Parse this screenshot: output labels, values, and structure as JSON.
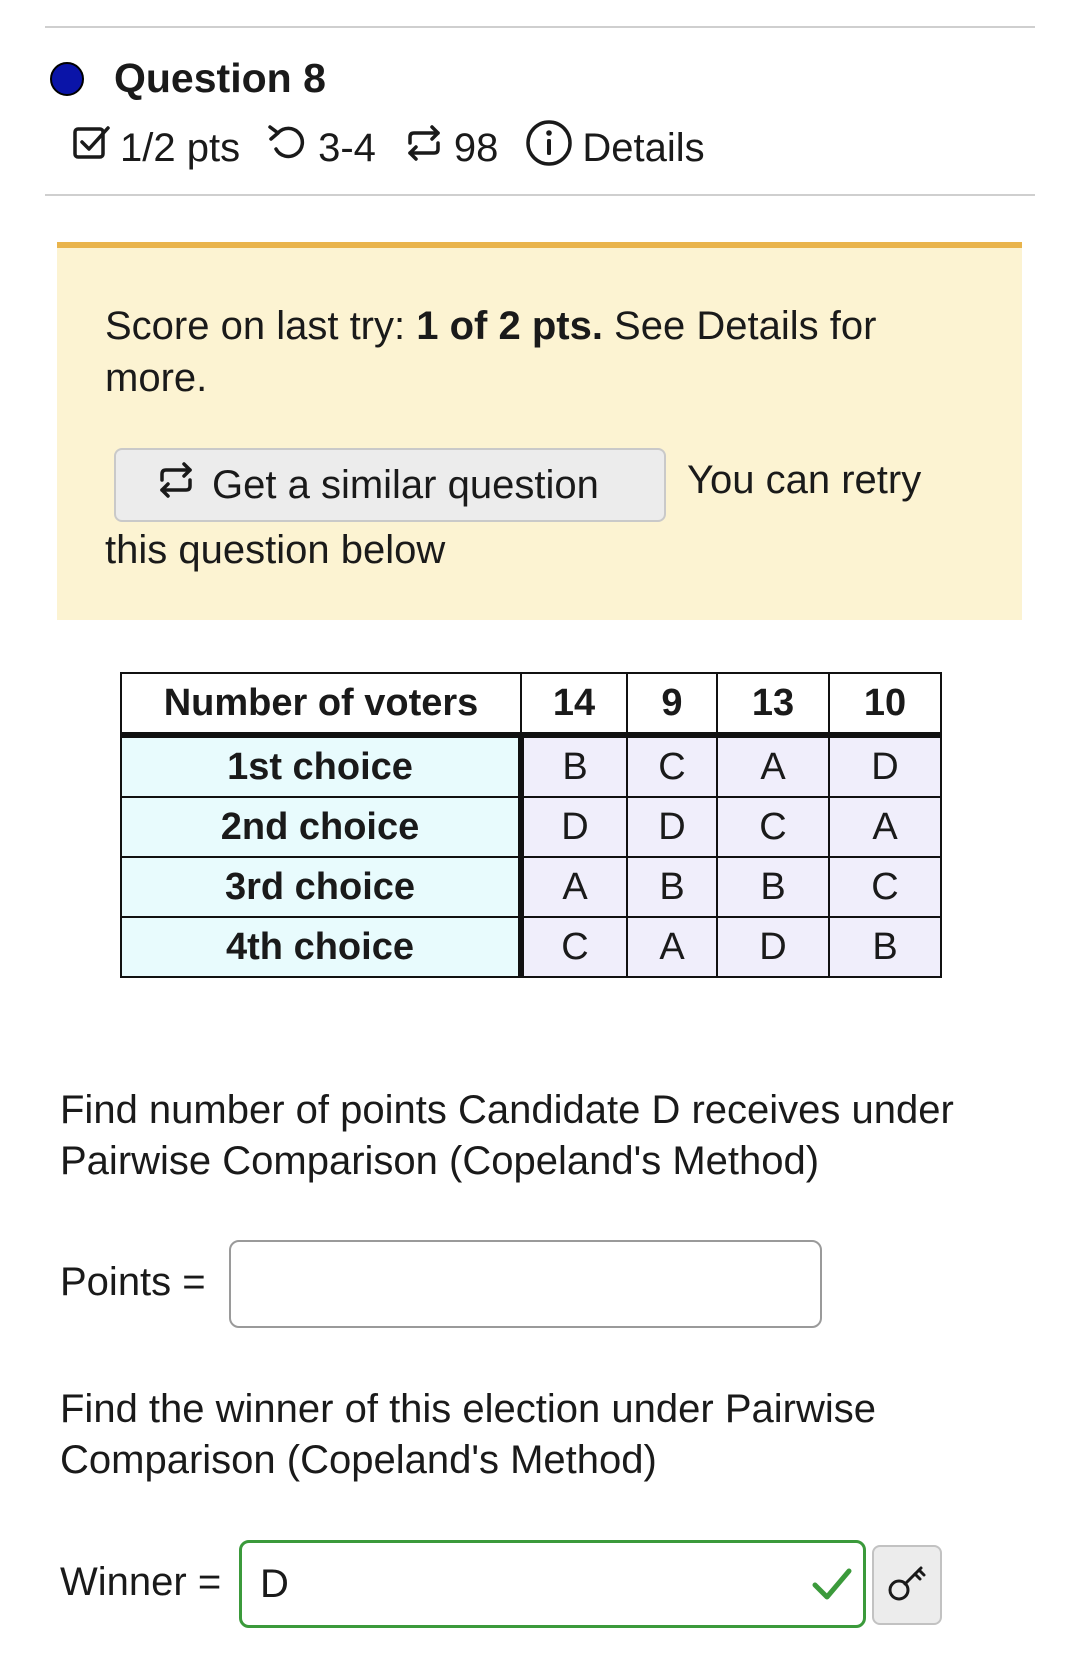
{
  "question": {
    "title": "Question 8",
    "points": "1/2 pts",
    "attempts": "3-4",
    "similar_count": "98",
    "details_label": "Details"
  },
  "notice": {
    "score_prefix": "Score on last try: ",
    "score_bold": "1 of 2 pts.",
    "score_suffix": " See Details for more.",
    "similar_button": "Get a similar question",
    "retry_line1": "You can retry",
    "retry_line2": "this question below"
  },
  "table": {
    "header": [
      "Number of voters",
      "14",
      "9",
      "13",
      "10"
    ],
    "rows": [
      {
        "label": "1st choice",
        "cells": [
          "B",
          "C",
          "A",
          "D"
        ]
      },
      {
        "label": "2nd choice",
        "cells": [
          "D",
          "D",
          "C",
          "A"
        ]
      },
      {
        "label": "3rd choice",
        "cells": [
          "A",
          "B",
          "B",
          "C"
        ]
      },
      {
        "label": "4th choice",
        "cells": [
          "C",
          "A",
          "D",
          "B"
        ]
      }
    ]
  },
  "part1": {
    "prompt": "Find number of points Candidate D receives under Pairwise Comparison (Copeland's Method)",
    "label": "Points =",
    "value": ""
  },
  "part2": {
    "prompt": "Find the winner of this election under Pairwise Comparison (Copeland's Method)",
    "label": "Winner =",
    "value": "D"
  },
  "colors": {
    "status_dot": "#0a14a8",
    "notice_bg": "#fcf3d2",
    "notice_border": "#e9b44c",
    "row_header_bg": "#e8fbfd",
    "cell_bg": "#f0eefb",
    "correct": "#3b9a3b"
  },
  "icons": {
    "points": "checkbox-icon",
    "attempts": "retry-icon",
    "similar": "similar-question-icon",
    "details": "info-icon",
    "correct": "checkmark-icon",
    "key": "key-icon"
  }
}
